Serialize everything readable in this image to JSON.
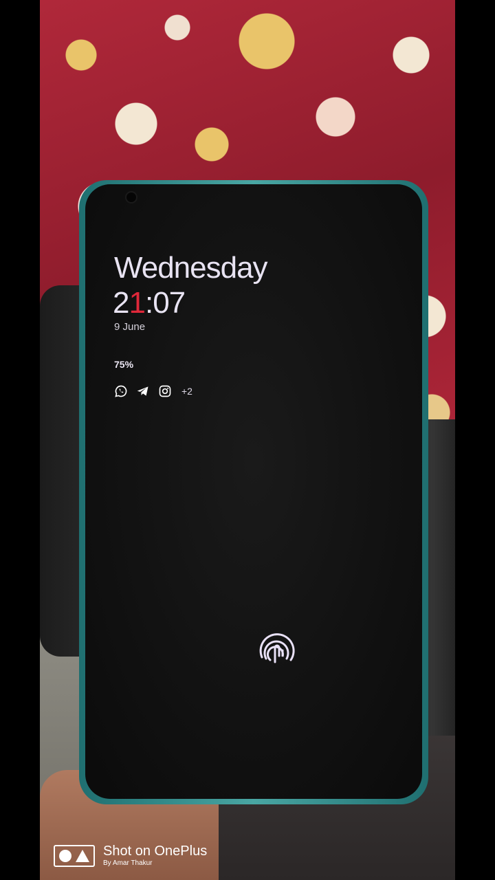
{
  "lockscreen": {
    "weekday": "Wednesday",
    "time_hour_first": "2",
    "time_hour_second": "1",
    "time_rest": ":07",
    "date": "9 June",
    "battery": "75%",
    "notification_icons": [
      "whatsapp-icon",
      "telegram-icon",
      "instagram-icon"
    ],
    "notification_more": "+2"
  },
  "watermark": {
    "title": "Shot on OnePlus",
    "credit": "By Amar Thakur"
  },
  "colors": {
    "clock_text": "#e8e3f2",
    "accent": "#e0283a",
    "fingerprint": "#e9e1f7",
    "phone_frame": "#49a6a3"
  }
}
